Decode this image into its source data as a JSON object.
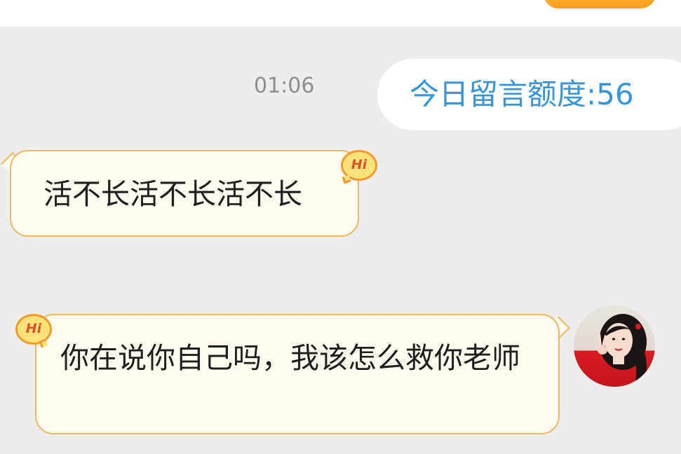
{
  "header": {
    "action_button_label": ""
  },
  "chat": {
    "timestamp": "01:06",
    "quota_text": "今日留言额度:56",
    "messages": [
      {
        "side": "incoming",
        "badge": "Hi",
        "text": "活不长活不长活不长"
      },
      {
        "side": "outgoing",
        "badge": "Hi",
        "text": "你在说你自己吗，我该怎么救你老师"
      }
    ]
  },
  "colors": {
    "background": "#ededed",
    "bubble_fill": "#fffbf0",
    "bubble_border": "#f2b85f",
    "quota_text": "#3a95d8",
    "timestamp": "#8e8e8e",
    "accent_orange": "#ff9d1e"
  },
  "icons": {
    "badge": "hi-speech-bubble-icon",
    "avatar": "user-avatar-photo"
  }
}
